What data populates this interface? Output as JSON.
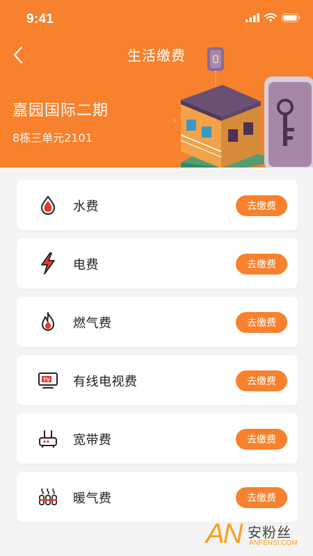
{
  "status_bar": {
    "time": "9:41"
  },
  "nav": {
    "title": "生活缴费",
    "back_icon": "chevron-left-icon"
  },
  "community": {
    "name": "嘉园国际二期",
    "address": "8栋三单元2101"
  },
  "colors": {
    "accent": "#f7812d",
    "icon_dark": "#222222",
    "icon_red": "#e5392d"
  },
  "bills": [
    {
      "label": "水费",
      "icon": "water-drop-icon",
      "action": "去缴费"
    },
    {
      "label": "电费",
      "icon": "lightning-icon",
      "action": "去缴费"
    },
    {
      "label": "燃气费",
      "icon": "flame-icon",
      "action": "去缴费"
    },
    {
      "label": "有线电视费",
      "icon": "tv-icon",
      "action": "去缴费"
    },
    {
      "label": "宽带费",
      "icon": "router-icon",
      "action": "去缴费"
    },
    {
      "label": "暖气费",
      "icon": "radiator-icon",
      "action": "去缴费"
    }
  ],
  "watermark": {
    "logo": "AN",
    "text": "安粉丝",
    "url": "ANFENSI.COM"
  }
}
